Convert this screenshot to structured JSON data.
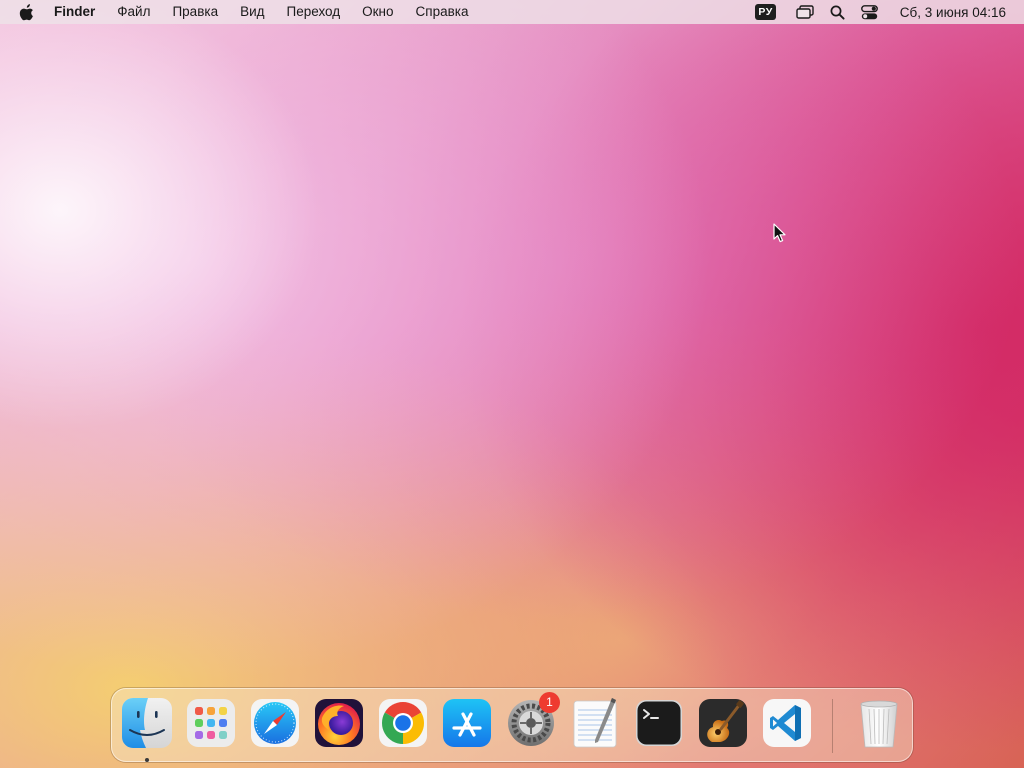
{
  "menubar": {
    "app_name": "Finder",
    "items": [
      "Файл",
      "Правка",
      "Вид",
      "Переход",
      "Окно",
      "Справка"
    ],
    "input_source": "РУ",
    "clock": "Сб, 3 июня  04:16"
  },
  "dock": {
    "apps": [
      {
        "name": "Finder",
        "icon": "finder-icon",
        "running": true
      },
      {
        "name": "Launchpad",
        "icon": "launchpad-icon"
      },
      {
        "name": "Safari",
        "icon": "safari-icon"
      },
      {
        "name": "Firefox",
        "icon": "firefox-icon"
      },
      {
        "name": "Google Chrome",
        "icon": "chrome-icon"
      },
      {
        "name": "App Store",
        "icon": "app-store-icon"
      },
      {
        "name": "System Settings",
        "icon": "system-settings-icon",
        "badge": "1"
      },
      {
        "name": "TextEdit",
        "icon": "textedit-icon"
      },
      {
        "name": "Terminal",
        "icon": "terminal-icon"
      },
      {
        "name": "GarageBand",
        "icon": "garageband-icon"
      },
      {
        "name": "Visual Studio Code",
        "icon": "vscode-icon"
      },
      {
        "name": "Trash",
        "icon": "trash-icon"
      }
    ]
  },
  "colors": {
    "menubar_bg": "#eee2e8",
    "badge_red": "#ee3b30",
    "wallpaper_pink": "#d8406e",
    "wallpaper_yellow": "#f5d26e"
  }
}
